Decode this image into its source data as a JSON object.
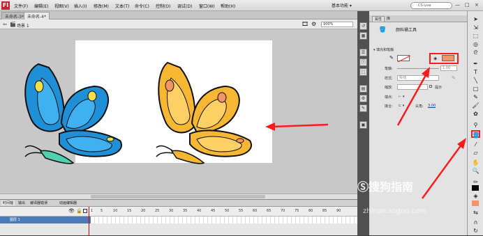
{
  "menubar": {
    "logo": "Fl",
    "items": [
      "文件(F)",
      "编辑(E)",
      "视图(V)",
      "插入(I)",
      "修改(M)",
      "文本(T)",
      "命令(C)",
      "控制(O)",
      "调试(D)",
      "窗口(W)",
      "帮助(H)"
    ],
    "workspace": "基本功能 ▾",
    "search_placeholder": "CS Live",
    "window_buttons": [
      "—",
      "□",
      "×"
    ]
  },
  "doc_tabs": [
    "未命名-3*",
    "未命名-4*"
  ],
  "editbar": {
    "scene": "场景 1",
    "zoom": "100%"
  },
  "timeline": {
    "tabs": [
      "时间轴",
      "输出",
      "编译器错误",
      "动画编辑器"
    ],
    "frame_numbers": [
      "1",
      "5",
      "10",
      "15",
      "20",
      "25",
      "30",
      "35",
      "40",
      "45",
      "50",
      "55",
      "60",
      "65",
      "70",
      "75",
      "80",
      "85",
      "90"
    ],
    "layer_name": "图层 1"
  },
  "props": {
    "tabs": [
      "属性",
      "库"
    ],
    "tool_name": "颜料桶工具",
    "section_title": "▾ 填充和笔触",
    "stroke_label": "笔触:",
    "stroke_value": "1.00",
    "style_label": "样式:",
    "style_value": "实线",
    "hint_label": "提示",
    "scale_label": "缩放:",
    "cap_label": "端点:",
    "join_label": "接合:",
    "miter_label": "尖角:",
    "miter_value": "3.00"
  },
  "colors": {
    "fill": "#f29465",
    "highlight": "#ff1a1a",
    "blue_butterfly": "#1f8fd8",
    "orange_butterfly": "#f7b733"
  },
  "watermark": {
    "line1": "Ⓢ搜狗指南",
    "line2": "zhinan.sogou.com"
  }
}
